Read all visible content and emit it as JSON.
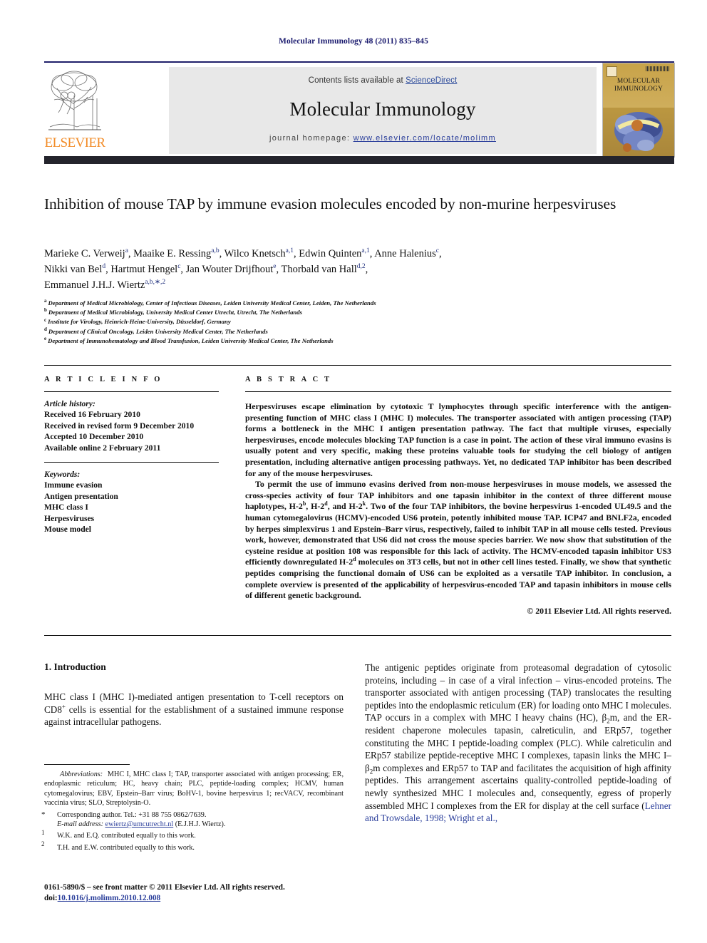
{
  "running_head": "Molecular Immunology 48 (2011) 835–845",
  "masthead": {
    "contents_prefix": "Contents lists available at ",
    "sciencedirect": "ScienceDirect",
    "journal_title": "Molecular Immunology",
    "homepage_prefix": "journal homepage:",
    "homepage_url": "www.elsevier.com/locate/molimm",
    "publisher_wordmark": "ELSEVIER",
    "cover_title_line1": "MOLECULAR",
    "cover_title_line2": "IMMUNOLOGY",
    "accent_blue": "#2b3f9b",
    "accent_orange": "#F28C28",
    "band_gray": "#e8e8e8"
  },
  "article": {
    "title": "Inhibition of mouse TAP by immune evasion molecules encoded by non-murine herpesviruses",
    "authors_line1": "Marieke C. Verweij<sup>a</sup>, Maaike E. Ressing<sup>a,b</sup>, Wilco Knetsch<sup>a,1</sup>, Edwin Quinten<sup>a,1</sup>, Anne Halenius<sup>c</sup>,",
    "authors_line2": "Nikki van Bel<sup>d</sup>, Hartmut Hengel<sup>c</sup>, Jan Wouter Drijfhout<sup>e</sup>, Thorbald van Hall<sup>d,2</sup>,",
    "authors_line3": "Emmanuel J.H.J. Wiertz<sup>a,b,∗,2</sup>",
    "affiliations": [
      {
        "marker": "a",
        "text": "Department of Medical Microbiology, Center of Infectious Diseases, Leiden University Medical Center, Leiden, The Netherlands"
      },
      {
        "marker": "b",
        "text": "Department of Medical Microbiology, University Medical Center Utrecht, Utrecht, The Netherlands"
      },
      {
        "marker": "c",
        "text": "Institute for Virology, Heinrich-Heine-University, Düsseldorf, Germany"
      },
      {
        "marker": "d",
        "text": "Department of Clinical Oncology, Leiden University Medical Center, The Netherlands"
      },
      {
        "marker": "e",
        "text": "Department of Immunohematology and Blood Transfusion, Leiden University Medical Center, The Netherlands"
      }
    ]
  },
  "article_info": {
    "heading": "A R T I C L E    I N F O",
    "history_label": "Article history:",
    "history": [
      "Received 16 February 2010",
      "Received in revised form 9 December 2010",
      "Accepted 10 December 2010",
      "Available online 2 February 2011"
    ],
    "keywords_label": "Keywords:",
    "keywords": [
      "Immune evasion",
      "Antigen presentation",
      "MHC class I",
      "Herpesviruses",
      "Mouse model"
    ]
  },
  "abstract": {
    "heading": "A B S T R A C T",
    "paragraph1": "Herpesviruses escape elimination by cytotoxic T lymphocytes through specific interference with the antigen-presenting function of MHC class I (MHC I) molecules. The transporter associated with antigen processing (TAP) forms a bottleneck in the MHC I antigen presentation pathway. The fact that multiple viruses, especially herpesviruses, encode molecules blocking TAP function is a case in point. The action of these viral immuno evasins is usually potent and very specific, making these proteins valuable tools for studying the cell biology of antigen presentation, including alternative antigen processing pathways. Yet, no dedicated TAP inhibitor has been described for any of the mouse herpesviruses.",
    "paragraph2": "To permit the use of immuno evasins derived from non-mouse herpesviruses in mouse models, we assessed the cross-species activity of four TAP inhibitors and one tapasin inhibitor in the context of three different mouse haplotypes, H-2<sup>b</sup>, H-2<sup>d</sup>, and H-2<sup>k</sup>. Two of the four TAP inhibitors, the bovine herpesvirus 1-encoded UL49.5 and the human cytomegalovirus (HCMV)-encoded US6 protein, potently inhibited mouse TAP. ICP47 and BNLF2a, encoded by herpes simplexvirus 1 and Epstein–Barr virus, respectively, failed to inhibit TAP in all mouse cells tested. Previous work, however, demonstrated that US6 did not cross the mouse species barrier. We now show that substitution of the cysteine residue at position 108 was responsible for this lack of activity. The HCMV-encoded tapasin inhibitor US3 efficiently downregulated H-2<sup>d</sup> molecules on 3T3 cells, but not in other cell lines tested. Finally, we show that synthetic peptides comprising the functional domain of US6 can be exploited as a versatile TAP inhibitor. In conclusion, a complete overview is presented of the applicability of herpesvirus-encoded TAP and tapasin inhibitors in mouse cells of different genetic background.",
    "copyright": "© 2011 Elsevier Ltd. All rights reserved."
  },
  "body": {
    "intro_heading": "1.  Introduction",
    "left_paragraph": "MHC class I (MHC I)-mediated antigen presentation to T-cell receptors on CD8<sup>+</sup> cells is essential for the establishment of a sustained immune response against intracellular pathogens.",
    "right_paragraph": "The antigenic peptides originate from proteasomal degradation of cytosolic proteins, including – in case of a viral infection – virus-encoded proteins. The transporter associated with antigen processing (TAP) translocates the resulting peptides into the endoplasmic reticulum (ER) for loading onto MHC I molecules. TAP occurs in a complex with MHC I heavy chains (HC), β<sub>2</sub>m, and the ER-resident chaperone molecules tapasin, calreticulin, and ERp57, together constituting the MHC I peptide-loading complex (PLC). While calreticulin and ERp57 stabilize peptide-receptive MHC I complexes, tapasin links the MHC I–β<sub>2</sub>m complexes and ERp57 to TAP and facilitates the acquisition of high affinity peptides. This arrangement ascertains quality-controlled peptide-loading of newly synthesized MHC I molecules and, consequently, egress of properly assembled MHC I complexes from the ER for display at the cell surface (<span class=\"cite\">Lehner and Trowsdale, 1998; Wright et al.,</span>"
  },
  "footnotes": {
    "abbreviations_label": "Abbreviations:",
    "abbreviations_text": "MHC I, MHC class I; TAP, transporter associated with antigen processing; ER, endoplasmic reticulum; HC, heavy chain; PLC, peptide-loading complex; HCMV, human cytomegalovirus; EBV, Epstein–Barr virus; BoHV-1, bovine herpesvirus 1; recVACV, recombinant vaccinia virus; SLO, Streptolysin-O.",
    "corresponding": "Corresponding author. Tel.: +31 88 755 0862/7639.",
    "email_label": "E-mail address:",
    "email": "ewiertz@umcutrecht.nl",
    "email_suffix": "(E.J.H.J. Wiertz).",
    "note1": "W.K. and E.Q. contributed equally to this work.",
    "note2": "T.H. and E.W. contributed equally to this work."
  },
  "footer": {
    "front_matter": "0161-5890/$ – see front matter © 2011 Elsevier Ltd. All rights reserved.",
    "doi_prefix": "doi:",
    "doi": "10.1016/j.molimm.2010.12.008"
  }
}
